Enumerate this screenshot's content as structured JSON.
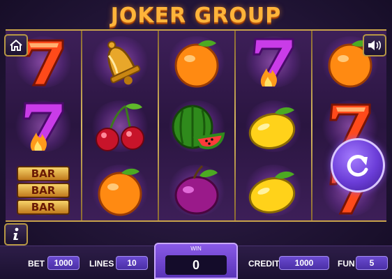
{
  "game": {
    "title": "JOKER GROUP"
  },
  "reels": [
    [
      "seven-orange-icon",
      "seven-purple-icon",
      "bar-stack-icon"
    ],
    [
      "bell-icon",
      "cherries-icon",
      "orange-icon"
    ],
    [
      "orange-icon",
      "watermelon-icon",
      "plum-icon"
    ],
    [
      "seven-purple-icon",
      "lemon-icon",
      "lemon-icon"
    ],
    [
      "orange-icon",
      "seven-orange-icon",
      "seven-orange-icon"
    ]
  ],
  "bar_symbol": {
    "rows": [
      "BAR",
      "BAR",
      "BAR"
    ]
  },
  "controls": {
    "home_icon": "home-icon",
    "sound_icon": "speaker-icon",
    "info_icon": "info-icon",
    "spin_icon": "spin-arrow-icon"
  },
  "bottom_bar": {
    "bet_label": "BET",
    "bet_value": "1000",
    "lines_label": "LINES",
    "lines_value": "10",
    "win_label": "WIN",
    "win_value": "0",
    "credit_label": "CREDIT",
    "credit_value": "1000",
    "fun_label": "FUN",
    "fun_value": "5"
  },
  "colors": {
    "title": "#ffb43a",
    "frame_gold": "#c8a34a",
    "accent_purple": "#6b3dd8",
    "background": "#221537"
  }
}
